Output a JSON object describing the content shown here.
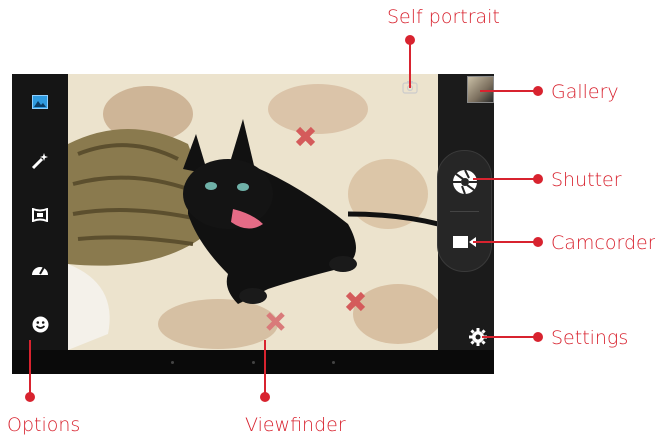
{
  "labels": {
    "self_portrait": "Self portrait",
    "gallery": "Gallery",
    "shutter": "Shutter",
    "camcorder": "Camcorder",
    "settings": "Settings",
    "options": "Options",
    "viewfinder": "Viewfinder"
  },
  "icons": {
    "options_bar": [
      "picture-icon",
      "magic-wand-icon",
      "panorama-icon",
      "speedometer-icon",
      "smiley-icon"
    ],
    "shutter": "shutter-aperture-icon",
    "camcorder": "video-camera-icon",
    "settings": "gear-icon",
    "self_portrait": "camera-switch-icon",
    "gallery": "gallery-thumbnail"
  },
  "colors": {
    "callout": "#d8232f",
    "active_option": "#2f9be0"
  }
}
